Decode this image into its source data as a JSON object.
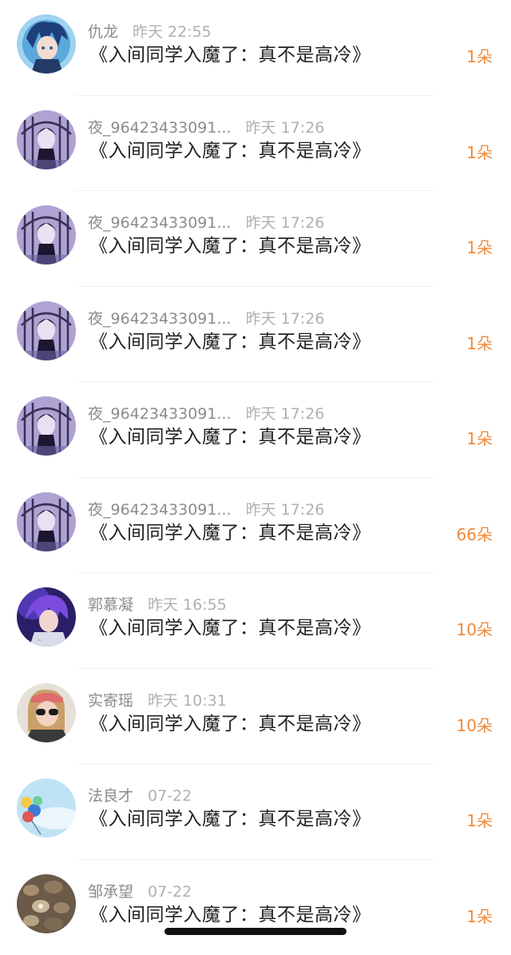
{
  "gifts": [
    {
      "user": "仇龙",
      "time": "昨天 22:55",
      "book": "《入间同学入魔了：真不是高冷》",
      "count": "1朵",
      "avatar": "anime-blue-hair-avatar"
    },
    {
      "user": "夜_96423433091...",
      "time": "昨天 17:26",
      "book": "《入间同学入魔了：真不是高冷》",
      "count": "1朵",
      "avatar": "anime-purple-gate-avatar"
    },
    {
      "user": "夜_96423433091...",
      "time": "昨天 17:26",
      "book": "《入间同学入魔了：真不是高冷》",
      "count": "1朵",
      "avatar": "anime-purple-gate-avatar"
    },
    {
      "user": "夜_96423433091...",
      "time": "昨天 17:26",
      "book": "《入间同学入魔了：真不是高冷》",
      "count": "1朵",
      "avatar": "anime-purple-gate-avatar"
    },
    {
      "user": "夜_96423433091...",
      "time": "昨天 17:26",
      "book": "《入间同学入魔了：真不是高冷》",
      "count": "1朵",
      "avatar": "anime-purple-gate-avatar"
    },
    {
      "user": "夜_96423433091...",
      "time": "昨天 17:26",
      "book": "《入间同学入魔了：真不是高冷》",
      "count": "66朵",
      "avatar": "anime-purple-gate-avatar"
    },
    {
      "user": "郭慕凝",
      "time": "昨天 16:55",
      "book": "《入间同学入魔了：真不是高冷》",
      "count": "10朵",
      "avatar": "anime-purple-hair-avatar"
    },
    {
      "user": "实寄瑶",
      "time": "昨天 10:31",
      "book": "《入间同学入魔了：真不是高冷》",
      "count": "10朵",
      "avatar": "sunglasses-girl-avatar"
    },
    {
      "user": "法良才",
      "time": "07-22",
      "book": "《入间同学入魔了：真不是高冷》",
      "count": "1朵",
      "avatar": "balloons-sky-avatar"
    },
    {
      "user": "邹承望",
      "time": "07-22",
      "book": "《入间同学入魔了：真不是高冷》",
      "count": "1朵",
      "avatar": "pebbles-avatar"
    }
  ],
  "colors": {
    "count": "#f08a3a",
    "title": "#222222",
    "meta": "#9a9a9a",
    "background": "#ffffff"
  }
}
